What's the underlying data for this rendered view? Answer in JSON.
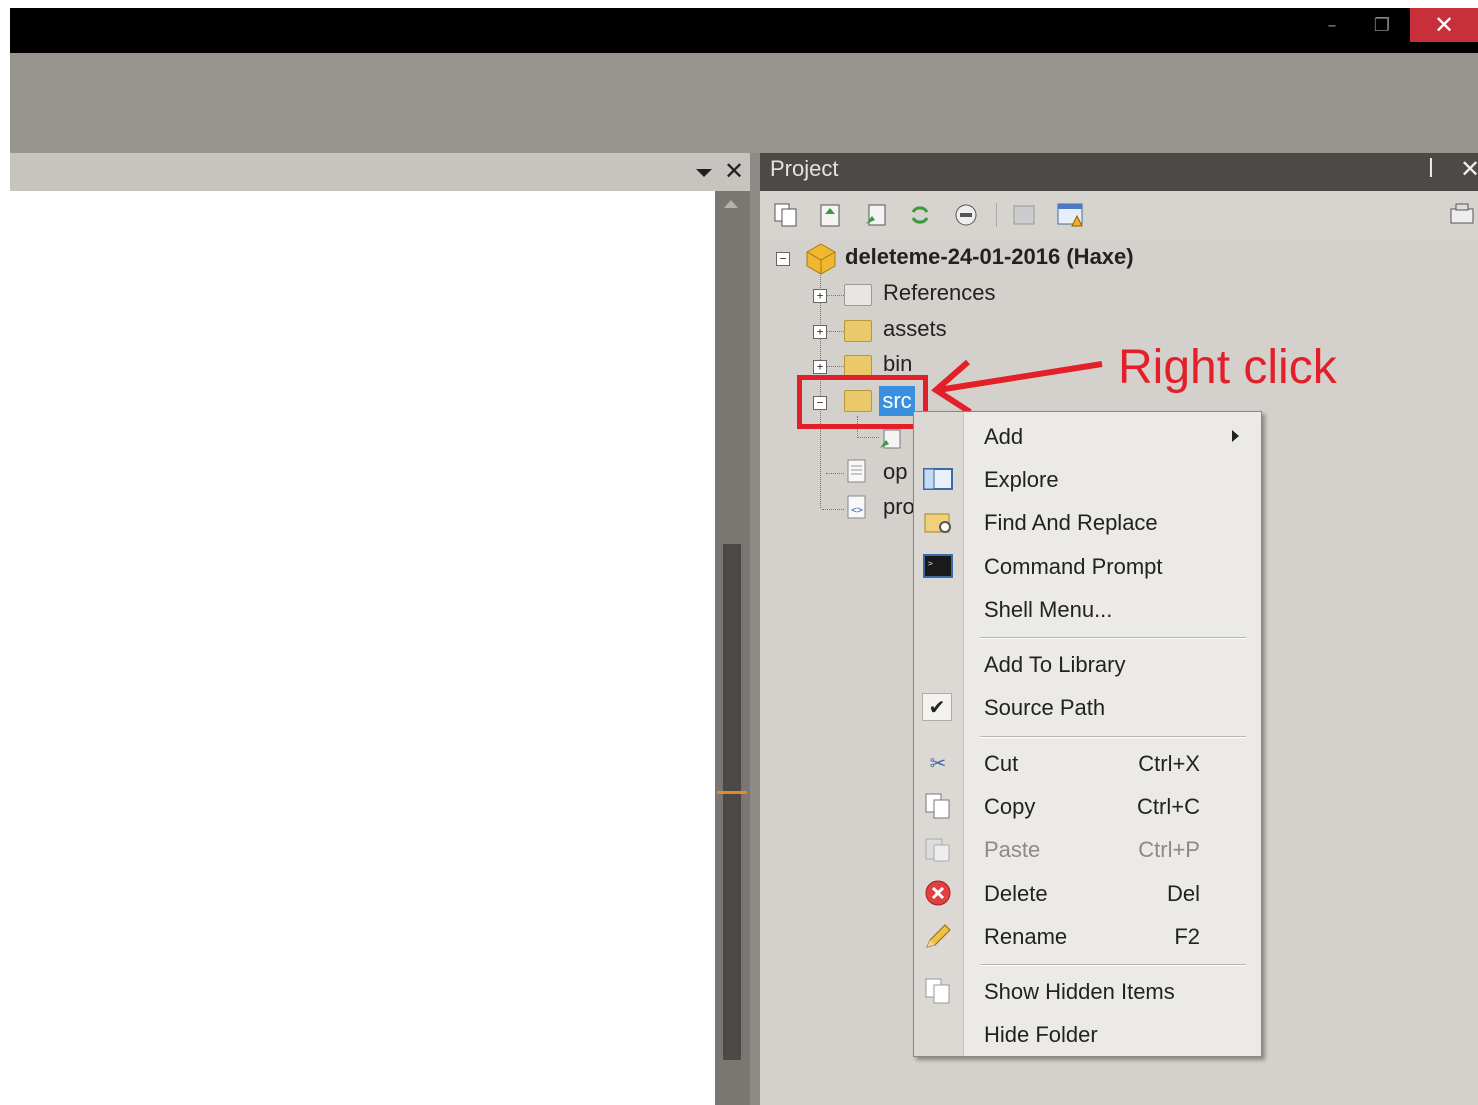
{
  "window": {
    "minimize_glyph": "–",
    "maximize_glyph": "❐",
    "close_glyph": "✕"
  },
  "left_panel": {
    "close_glyph": "✕"
  },
  "project_panel": {
    "title": "Project",
    "pin_glyph": "ꟾ",
    "close_glyph": "✕",
    "toolbar_icons": [
      "copy-icon",
      "paste-icon",
      "build-icon",
      "refresh-icon",
      "collapse-icon",
      "settings-icon",
      "properties-icon",
      "view-icon"
    ]
  },
  "tree": {
    "root": "deleteme-24-01-2016 (Haxe)",
    "items": [
      {
        "label": "References"
      },
      {
        "label": "assets"
      },
      {
        "label": "bin"
      },
      {
        "label": "src"
      },
      {
        "label": "op"
      },
      {
        "label": "pro"
      }
    ]
  },
  "annotation": {
    "text": "Right click"
  },
  "context_menu": {
    "items": [
      {
        "label": "Add",
        "shortcut": "",
        "submenu": true
      },
      {
        "label": "Explore",
        "shortcut": ""
      },
      {
        "label": "Find And Replace",
        "shortcut": ""
      },
      {
        "label": "Command Prompt",
        "shortcut": ""
      },
      {
        "label": "Shell Menu...",
        "shortcut": ""
      },
      {
        "label": "Add To Library",
        "shortcut": ""
      },
      {
        "label": "Source Path",
        "shortcut": "",
        "checked": true
      },
      {
        "label": "Cut",
        "shortcut": "Ctrl+X"
      },
      {
        "label": "Copy",
        "shortcut": "Ctrl+C"
      },
      {
        "label": "Paste",
        "shortcut": "Ctrl+P",
        "disabled": true
      },
      {
        "label": "Delete",
        "shortcut": "Del"
      },
      {
        "label": "Rename",
        "shortcut": "F2"
      },
      {
        "label": "Show Hidden Items",
        "shortcut": ""
      },
      {
        "label": "Hide Folder",
        "shortcut": ""
      }
    ]
  },
  "colors": {
    "accent_red": "#e3202a",
    "selection_blue": "#3a8fde"
  }
}
